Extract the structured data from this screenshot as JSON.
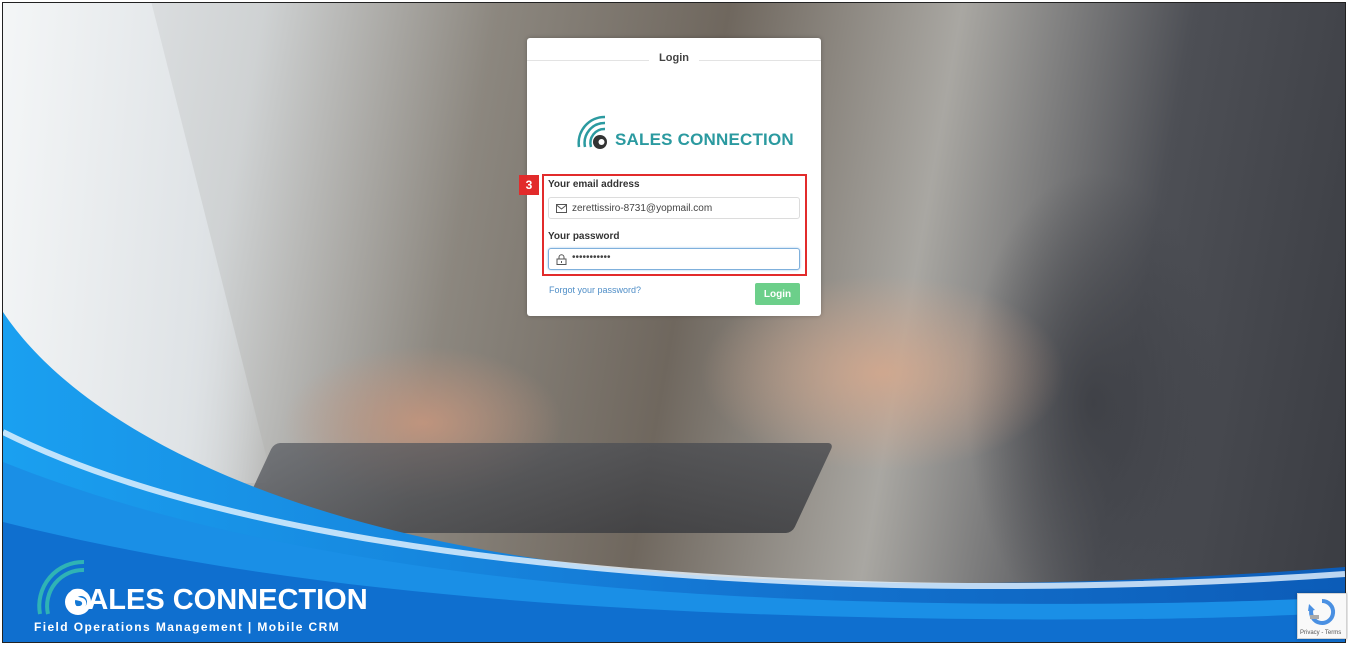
{
  "login_card": {
    "title": "Login",
    "logo_text": "SALES CONNECTION",
    "email_label": "Your email address",
    "email_value": "zerettissiro-8731@yopmail.com",
    "password_label": "Your password",
    "password_value": "•••••••••••",
    "forgot_link": "Forgot your password?",
    "login_button": "Login"
  },
  "annotation": {
    "step": "3",
    "color": "#e22b2b"
  },
  "footer_brand": {
    "name": "SALES CONNECTION",
    "tagline": "Field Operations Management | Mobile CRM"
  },
  "recaptcha": {
    "text": "Privacy - Terms"
  },
  "colors": {
    "brand_teal": "#2b9aa0",
    "login_green": "#6ccf8a",
    "link_blue": "#4f8ec7",
    "wave_blue": "#1f8fe0"
  },
  "icons": {
    "email": "envelope-icon",
    "password": "lock-icon",
    "logo": "wifi-c-logo-icon"
  }
}
